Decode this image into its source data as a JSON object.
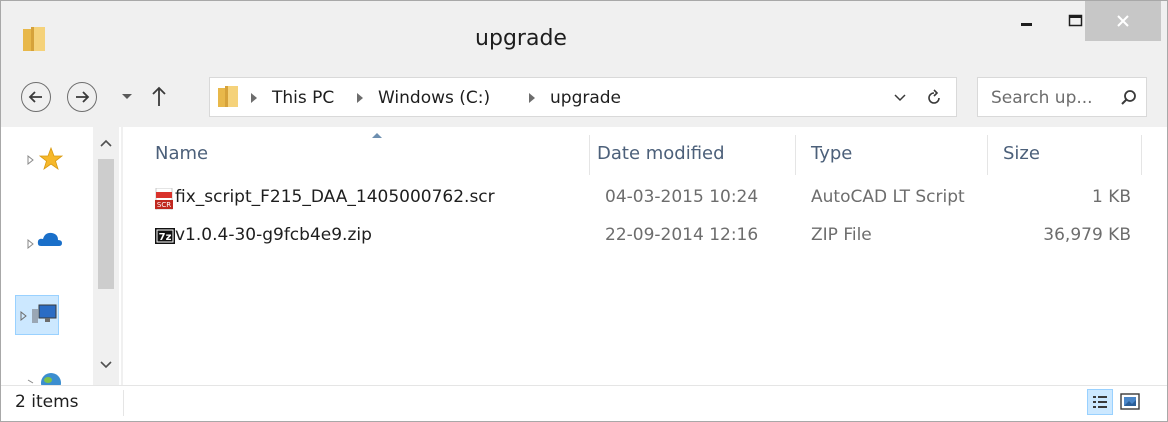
{
  "window": {
    "title": "upgrade"
  },
  "address": {
    "crumbs": [
      "This PC",
      "Windows (C:)",
      "upgrade"
    ]
  },
  "search": {
    "placeholder": "Search up..."
  },
  "columns": {
    "name": "Name",
    "date": "Date modified",
    "type": "Type",
    "size": "Size"
  },
  "files": [
    {
      "name": "fix_script_F215_DAA_1405000762.scr",
      "date": "04-03-2015 10:24",
      "type": "AutoCAD LT Script",
      "size": "1 KB",
      "icon": "scr-file-icon"
    },
    {
      "name": "v1.0.4-30-g9fcb4e9.zip",
      "date": "22-09-2014 12:16",
      "type": "ZIP File",
      "size": "36,979 KB",
      "icon": "7z-archive-icon"
    }
  ],
  "status": {
    "items": "2 items"
  },
  "colors": {
    "folder": "#e8b84a",
    "selection": "#cce8ff",
    "header_text": "#4c607a"
  }
}
